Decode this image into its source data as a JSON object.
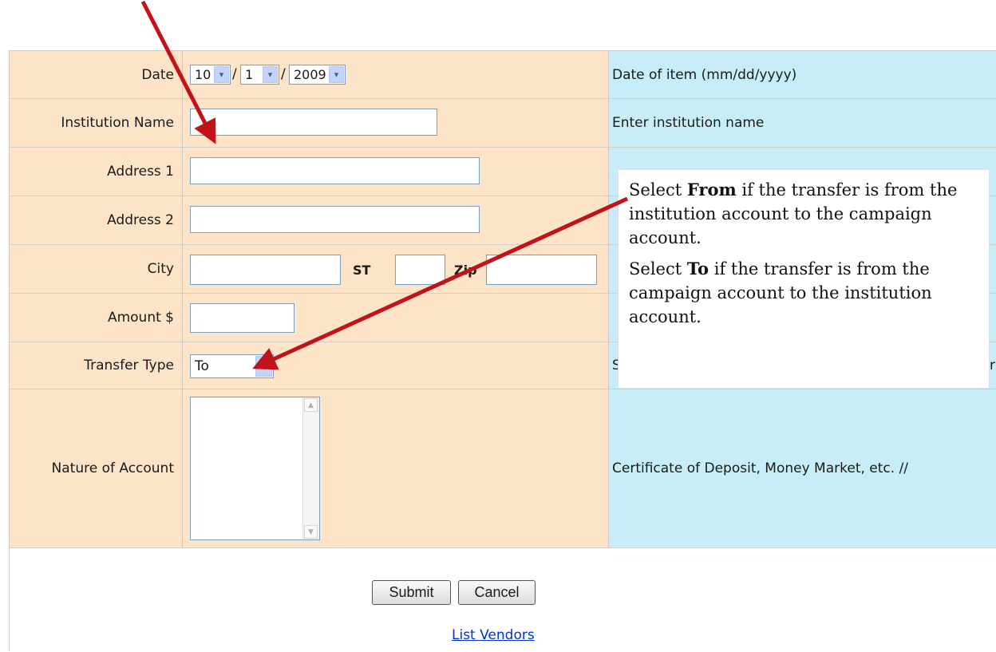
{
  "form": {
    "date": {
      "label": "Date",
      "month": "10",
      "day": "1",
      "year": "2009",
      "separator": "/",
      "help": "Date of item (mm/dd/yyyy)"
    },
    "institution_name": {
      "label": "Institution Name",
      "value": "",
      "help": "Enter institution name"
    },
    "address1": {
      "label": "Address 1",
      "value": ""
    },
    "address2": {
      "label": "Address 2",
      "value": ""
    },
    "city": {
      "label": "City",
      "value": "",
      "state_label": "ST",
      "zip_label": "Zip"
    },
    "amount": {
      "label": "Amount $",
      "value": ""
    },
    "transfer_type": {
      "label": "Transfer Type",
      "value": "To",
      "help_fragment_left": "S",
      "help_fragment_right": "r"
    },
    "nature_of_account": {
      "label": "Nature of Account",
      "value": "",
      "help": "Certificate of Deposit, Money Market, etc. //"
    }
  },
  "actions": {
    "submit": "Submit",
    "cancel": "Cancel",
    "list_vendors": "List Vendors"
  },
  "callout": {
    "p1_pre": "Select ",
    "p1_bold": "From",
    "p1_post": " if the transfer is from the institution account to the campaign account.",
    "p2_pre": "Select ",
    "p2_bold": "To",
    "p2_post": " if the transfer is from the campaign account to the institution account."
  },
  "colors": {
    "label_bg": "#fde3c7",
    "help_bg": "#c7eef8",
    "arrow": "#c0141a",
    "link": "#0033cc"
  }
}
